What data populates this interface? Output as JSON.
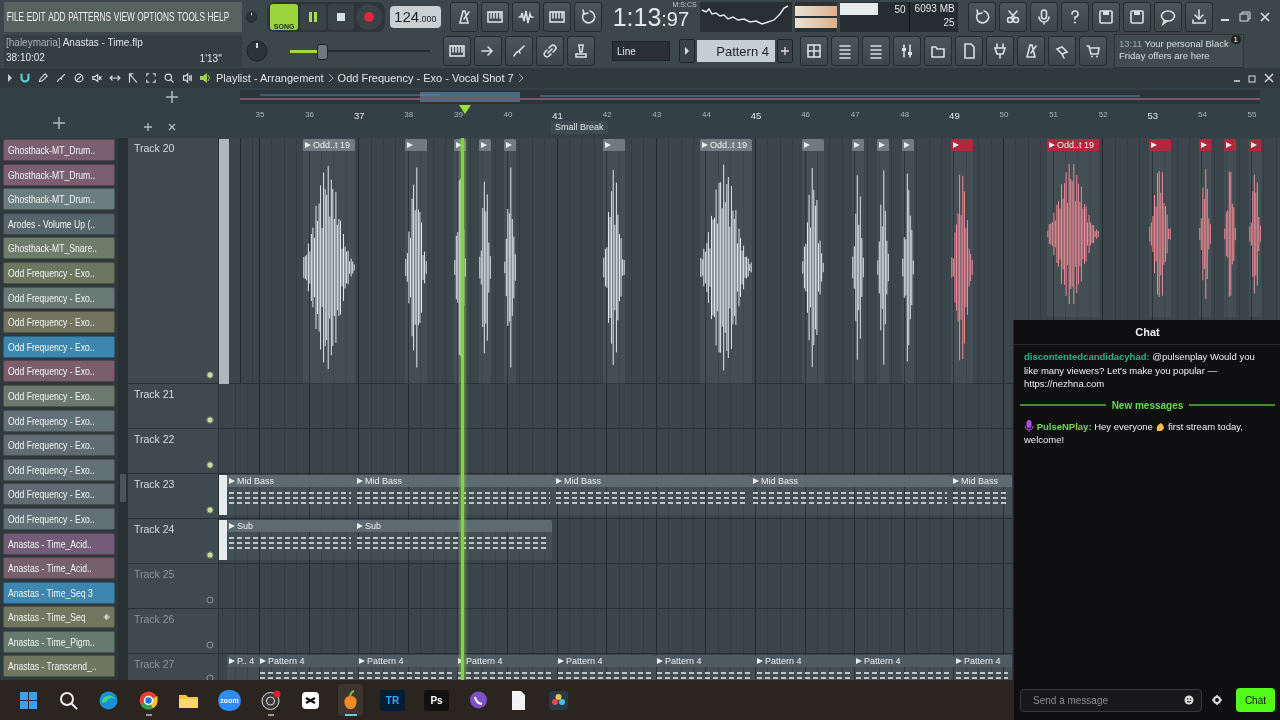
{
  "menu": [
    "FILE",
    "EDIT",
    "ADD",
    "PATTERNS",
    "VIEW",
    "OPTIONS",
    "TOOLS",
    "HELP"
  ],
  "project": {
    "user": "[haleymaria]",
    "file": "Anastas - Time.flp",
    "time": "38:10:02",
    "length": "1'13''"
  },
  "transport": {
    "mode_label": "SONG",
    "song_mode": true,
    "playing": true
  },
  "tempo": {
    "whole": "124",
    "fraction": ".000"
  },
  "clock": {
    "time": "1:13",
    "fraction": ":97",
    "unit": "M:S:CS"
  },
  "monitor": {
    "cpu": "50",
    "level": 0.55,
    "memory": "6093 MB",
    "polyphony": "25"
  },
  "master_volume": {
    "level": 0.22
  },
  "snap": "Line",
  "pattern": "Pattern 4",
  "news": {
    "time": "13:11",
    "text": "Your personal Black Friday offers are here",
    "badge": "1"
  },
  "playlist": {
    "path": [
      "Playlist - Arrangement",
      "Odd Frequency - Exo - Vocal Shot 7"
    ]
  },
  "ruler": {
    "bars": [
      "35",
      "36",
      "37",
      "38",
      "39",
      "40",
      "41",
      "42",
      "43",
      "44",
      "45",
      "46",
      "47",
      "48",
      "49",
      "50",
      "51",
      "52",
      "53",
      "54",
      "55"
    ],
    "marker": "Small Break"
  },
  "channels": [
    {
      "name": "Ghosthack-MT_Drum..",
      "color": "#7a5f6e"
    },
    {
      "name": "Ghosthack-MT_Drum..",
      "color": "#7a5f6e"
    },
    {
      "name": "Ghosthack-MT_Drum..",
      "color": "#6b7d7c"
    },
    {
      "name": "Arodes - Volume Up (..",
      "color": "#56646c"
    },
    {
      "name": "Ghosthack-MT_Snare..",
      "color": "#6e7d6a"
    },
    {
      "name": "Odd Frequency - Exo..",
      "color": "#6d7660"
    },
    {
      "name": "Odd Frequency - Exo..",
      "color": "#687a73"
    },
    {
      "name": "Odd Frequency - Exo..",
      "color": "#73745f"
    },
    {
      "name": "Odd Frequency - Exo..",
      "color": "#3d86b0"
    },
    {
      "name": "Odd Frequency - Exo..",
      "color": "#7a5f6a"
    },
    {
      "name": "Odd Frequency - Exo..",
      "color": "#6a7a6e"
    },
    {
      "name": "Odd Frequency - Exo..",
      "color": "#627078"
    },
    {
      "name": "Odd Frequency - Exo..",
      "color": "#5f6c74"
    },
    {
      "name": "Odd Frequency - Exo..",
      "color": "#627078"
    },
    {
      "name": "Odd Frequency - Exo..",
      "color": "#5f6c74"
    },
    {
      "name": "Odd Frequency - Exo..",
      "color": "#627078"
    },
    {
      "name": "Anastas - Time_Acid..",
      "color": "#745c78"
    },
    {
      "name": "Anastas - Time_Acid..",
      "color": "#76606c"
    },
    {
      "name": "Anastas - Time_Seq 3",
      "color": "#3d86b0"
    },
    {
      "name": "Anastas - Time_Seq",
      "color": "#737760"
    },
    {
      "name": "Anastas - Time_Pigm..",
      "color": "#667a70"
    },
    {
      "name": "Anastas - Transcend_..",
      "color": "#707660"
    }
  ],
  "tracks": [
    {
      "name": "Track 20",
      "enabled": true,
      "clips": [
        {
          "kind": "audio",
          "color": "#aeb8bd"
        },
        {
          "kind": "audio",
          "color": "#6f7b80",
          "label": "Odd..t 19"
        },
        {
          "kind": "audio",
          "color": "#6f7b80"
        },
        {
          "kind": "audio",
          "color": "#6f7b80"
        },
        {
          "kind": "audio",
          "color": "#6f7b80"
        },
        {
          "kind": "audio",
          "color": "#6f7b80"
        },
        {
          "kind": "audio",
          "color": "#6f7b80"
        },
        {
          "kind": "audio",
          "color": "#6f7b80",
          "label": "Odd..t 19"
        },
        {
          "kind": "audio",
          "color": "#6f7b80"
        },
        {
          "kind": "audio",
          "color": "#6f7b80"
        },
        {
          "kind": "audio",
          "color": "#6f7b80"
        },
        {
          "kind": "audio",
          "color": "#6f7b80"
        },
        {
          "kind": "audio",
          "color": "#b3263c"
        },
        {
          "kind": "audio",
          "color": "#b3263c",
          "label": "Odd..t 19"
        },
        {
          "kind": "audio",
          "color": "#b3263c"
        },
        {
          "kind": "audio",
          "color": "#b3263c"
        },
        {
          "kind": "audio",
          "color": "#b3263c"
        },
        {
          "kind": "audio",
          "color": "#b3263c"
        }
      ]
    },
    {
      "name": "Track 21",
      "enabled": true
    },
    {
      "name": "Track 22",
      "enabled": true
    },
    {
      "name": "Track 23",
      "enabled": true,
      "clips": [
        {
          "kind": "pattern",
          "color": "#e8ecee"
        },
        {
          "kind": "pattern",
          "color": "#5d6a71",
          "label": "Mid Bass"
        },
        {
          "kind": "pattern",
          "color": "#5d6a71",
          "label": "Mid Bass"
        },
        {
          "kind": "pattern",
          "color": "#5d6a71",
          "label": "Mid Bass"
        },
        {
          "kind": "pattern",
          "color": "#5d6a71",
          "label": "Mid Bass"
        },
        {
          "kind": "pattern",
          "color": "#5d6a71",
          "label": "Mid Bass"
        }
      ]
    },
    {
      "name": "Track 24",
      "enabled": true,
      "clips": [
        {
          "kind": "pattern",
          "color": "#e8ecee"
        },
        {
          "kind": "pattern",
          "color": "#5d6a71",
          "label": "Sub"
        },
        {
          "kind": "pattern",
          "color": "#5d6a71",
          "label": "Sub"
        }
      ]
    },
    {
      "name": "Track 25",
      "enabled": false
    },
    {
      "name": "Track 26",
      "enabled": false
    },
    {
      "name": "Track 27",
      "enabled": false,
      "clips": [
        {
          "kind": "pattern",
          "color": "#4f5b62",
          "label": "P.. 4"
        },
        {
          "kind": "pattern",
          "color": "#4f5b62",
          "label": "Pattern 4"
        },
        {
          "kind": "pattern",
          "color": "#4f5b62",
          "label": "Pattern 4"
        },
        {
          "kind": "pattern",
          "color": "#4f5b62",
          "label": "Pattern 4"
        },
        {
          "kind": "pattern",
          "color": "#4f5b62",
          "label": "Pattern 4"
        },
        {
          "kind": "pattern",
          "color": "#4f5b62",
          "label": "Pattern 4"
        },
        {
          "kind": "pattern",
          "color": "#4f5b62",
          "label": "Pattern 4"
        },
        {
          "kind": "pattern",
          "color": "#4f5b62",
          "label": "Pattern 4"
        },
        {
          "kind": "pattern",
          "color": "#4f5b62",
          "label": "Pattern 4"
        }
      ]
    }
  ],
  "chat": {
    "title": "Chat",
    "messages": [
      {
        "user": "discontentedcandidacyhad:",
        "color": "#21b58f",
        "text": "@pulsenplay Would you like many viewers? Let's make you popular — https://nezhna.com"
      }
    ],
    "divider": "New messages",
    "new_messages": [
      {
        "user": "PulseNPlay:",
        "color": "#5fe03a",
        "text_before": "Hey everyone",
        "text_after": "first stream today,",
        "text_continued": "welcome!"
      }
    ],
    "placeholder": "Send a message",
    "send": "Chat"
  },
  "taskbar": [
    {
      "kind": "start",
      "selected": false,
      "running": false
    },
    {
      "kind": "search",
      "selected": false,
      "running": false
    },
    {
      "kind": "edge",
      "selected": false,
      "running": false
    },
    {
      "kind": "chrome",
      "selected": false,
      "running": true
    },
    {
      "kind": "files",
      "selected": false,
      "running": false
    },
    {
      "kind": "zoom",
      "label": "zoom",
      "selected": false,
      "running": false
    },
    {
      "kind": "obs",
      "selected": false,
      "running": true
    },
    {
      "kind": "capcut",
      "selected": false,
      "running": false
    },
    {
      "kind": "flstudio",
      "selected": true,
      "running": true
    },
    {
      "kind": "tile",
      "label": "TR",
      "selected": false,
      "running": false
    },
    {
      "kind": "tile",
      "label": "Ps",
      "selected": false,
      "running": false
    },
    {
      "kind": "viber",
      "selected": false,
      "running": false
    },
    {
      "kind": "document",
      "selected": false,
      "running": false
    },
    {
      "kind": "resolve",
      "selected": false,
      "running": false
    }
  ]
}
